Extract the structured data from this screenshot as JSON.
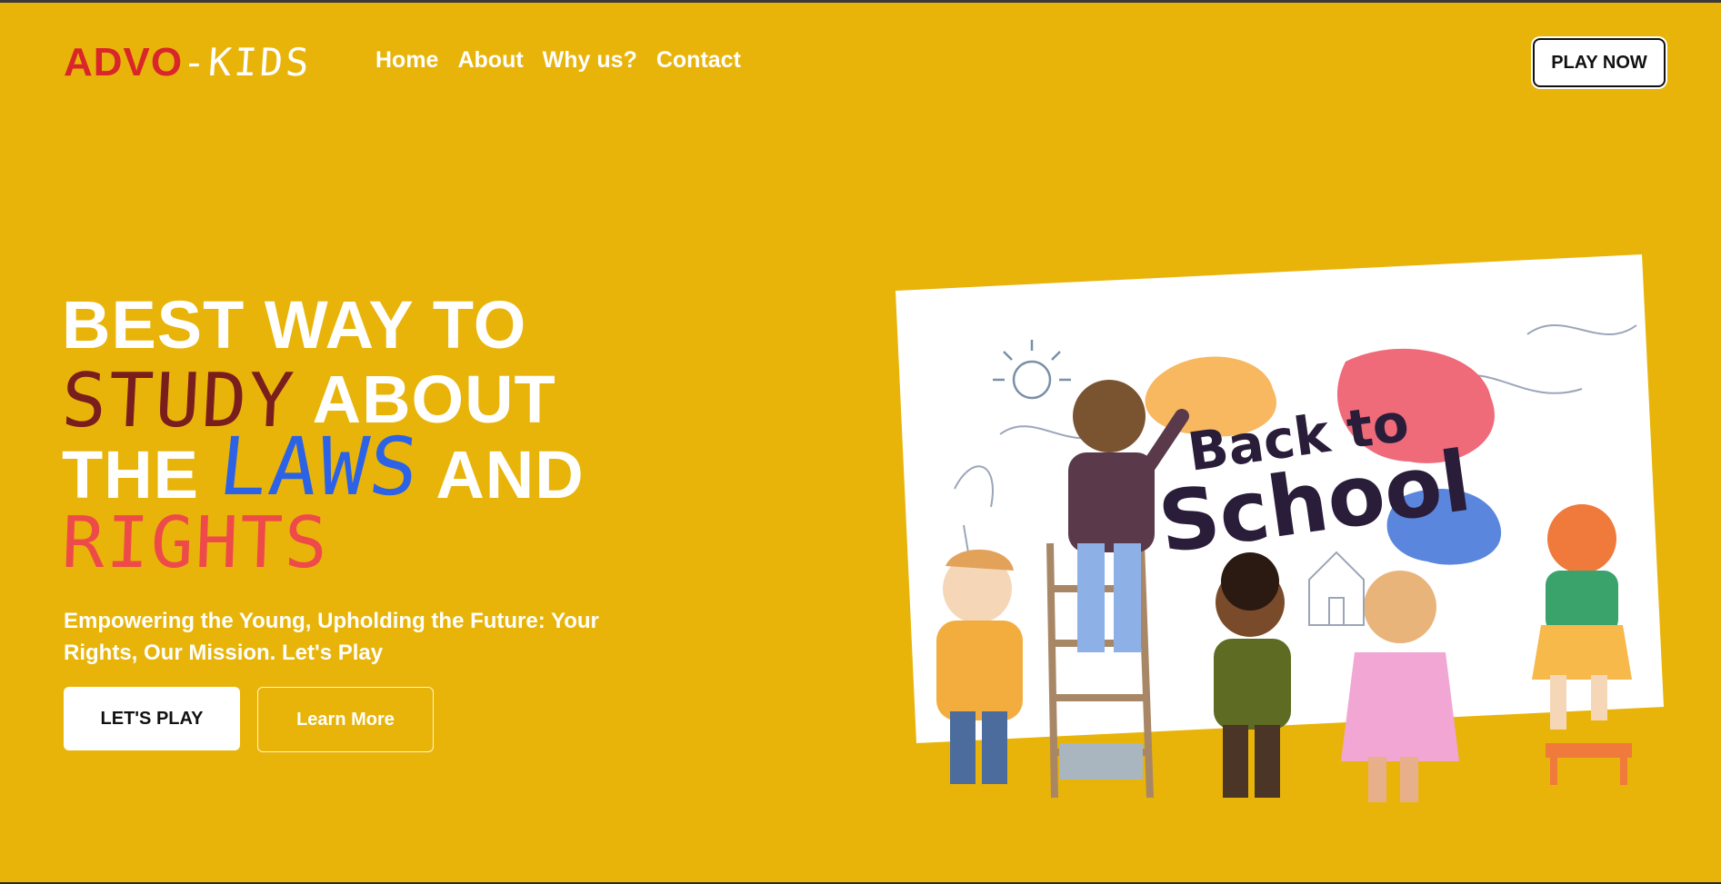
{
  "brand": {
    "part1": "ADVO",
    "part2": "-KIDS"
  },
  "nav": {
    "items": [
      {
        "label": "Home"
      },
      {
        "label": "About"
      },
      {
        "label": "Why us?"
      },
      {
        "label": "Contact"
      }
    ]
  },
  "header": {
    "cta_label": "PLAY NOW"
  },
  "hero": {
    "line1": "BEST WAY TO",
    "word_study": "STUDY",
    "line2_rest": "ABOUT",
    "line3_start": "THE",
    "word_laws": "LAWS",
    "line3_end": "AND",
    "word_rights": "RIGHTS",
    "subtitle": "Empowering the Young, Upholding the Future: Your Rights, Our Mission. Let's Play",
    "primary_button": "LET'S PLAY",
    "secondary_button": "Learn More"
  },
  "illustration": {
    "title_line1": "Back to",
    "title_line2": "School"
  },
  "colors": {
    "background": "#e8b40a",
    "brand_red": "#d8262a",
    "study": "#7a1d1d",
    "laws": "#2c63e6",
    "rights": "#ee4a4a"
  }
}
